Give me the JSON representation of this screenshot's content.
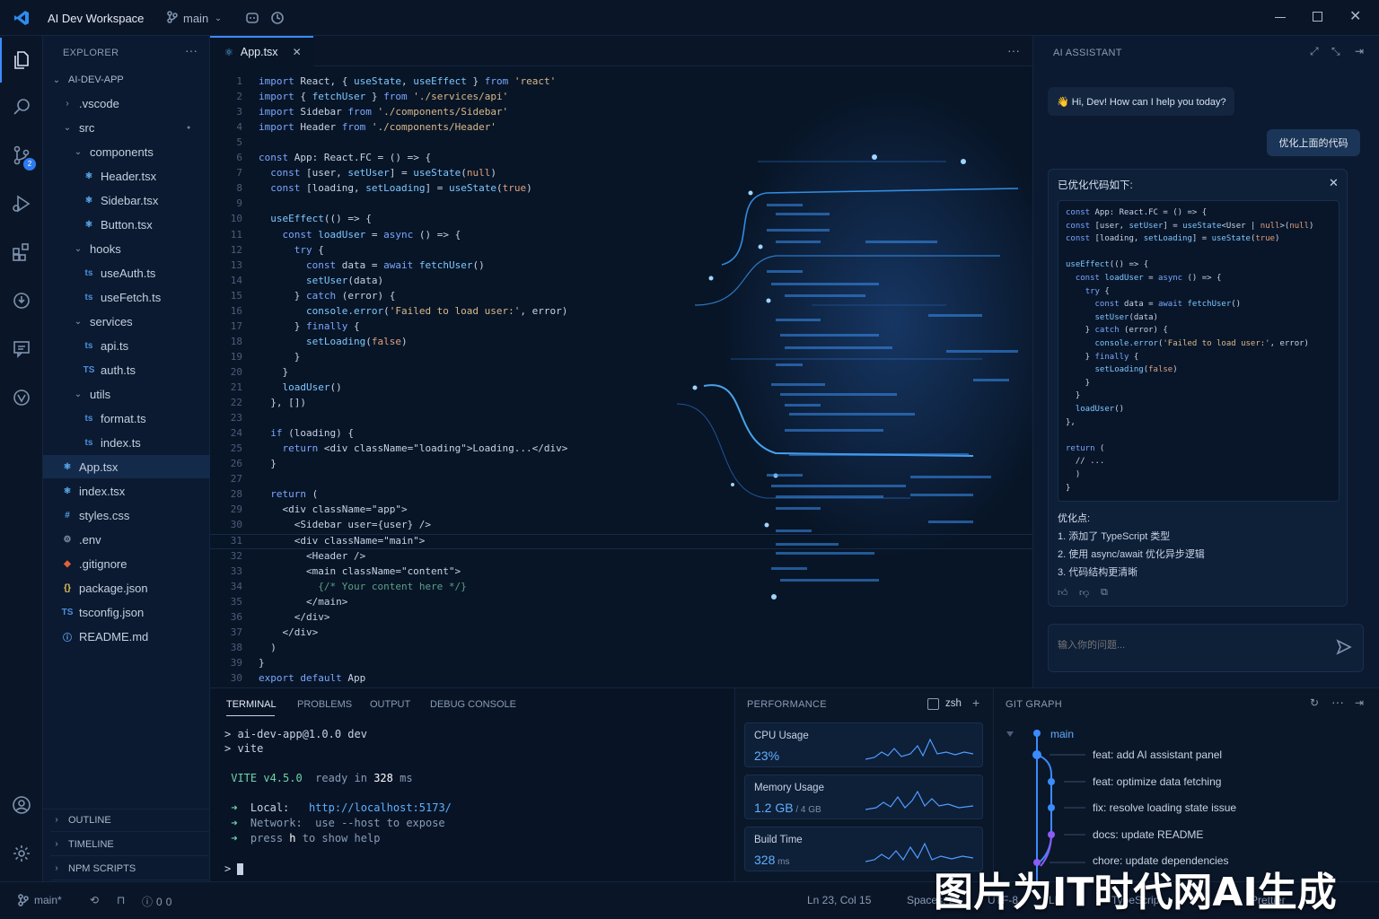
{
  "window": {
    "app_title": "AI Dev Workspace",
    "branch": "main"
  },
  "explorer": {
    "title": "EXPLORER",
    "root": "AI-DEV-APP",
    "items": [
      {
        "label": ".vscode",
        "kind": "folder-closed",
        "depth": 1
      },
      {
        "label": "src",
        "kind": "folder-open",
        "depth": 1
      },
      {
        "label": "components",
        "kind": "folder-open",
        "depth": 2
      },
      {
        "label": "Header.tsx",
        "kind": "tsx",
        "depth": 3
      },
      {
        "label": "Sidebar.tsx",
        "kind": "tsx",
        "depth": 3
      },
      {
        "label": "Button.tsx",
        "kind": "tsx",
        "depth": 3
      },
      {
        "label": "hooks",
        "kind": "folder-open",
        "depth": 2
      },
      {
        "label": "useAuth.ts",
        "kind": "ts",
        "depth": 3
      },
      {
        "label": "useFetch.ts",
        "kind": "ts",
        "depth": 3
      },
      {
        "label": "services",
        "kind": "folder-open",
        "depth": 2
      },
      {
        "label": "api.ts",
        "kind": "ts",
        "depth": 3
      },
      {
        "label": "auth.ts",
        "kind": "ts2",
        "depth": 3
      },
      {
        "label": "utils",
        "kind": "folder-open",
        "depth": 2
      },
      {
        "label": "format.ts",
        "kind": "ts",
        "depth": 3
      },
      {
        "label": "index.ts",
        "kind": "ts",
        "depth": 3
      },
      {
        "label": "App.tsx",
        "kind": "tsx",
        "depth": 1,
        "active": true
      },
      {
        "label": "index.tsx",
        "kind": "tsx",
        "depth": 1
      },
      {
        "label": "styles.css",
        "kind": "css",
        "depth": 1
      },
      {
        "label": ".env",
        "kind": "env",
        "depth": 1
      },
      {
        "label": ".gitignore",
        "kind": "git",
        "depth": 1
      },
      {
        "label": "package.json",
        "kind": "json",
        "depth": 1
      },
      {
        "label": "tsconfig.json",
        "kind": "tsconfig",
        "depth": 1
      },
      {
        "label": "README.md",
        "kind": "md",
        "depth": 1
      }
    ],
    "sections": [
      "OUTLINE",
      "TIMELINE",
      "NPM SCRIPTS"
    ]
  },
  "editor": {
    "tab_label": "App.tsx",
    "line_numbers": [
      "1",
      "2",
      "3",
      "4",
      "5",
      "6",
      "7",
      "8",
      "9",
      "10",
      "11",
      "12",
      "13",
      "14",
      "15",
      "16",
      "17",
      "18",
      "19",
      "20",
      "21",
      "22",
      "23",
      "24",
      "25",
      "26",
      "27",
      "28",
      "29",
      "30",
      "31",
      "32",
      "33",
      "34",
      "35",
      "36",
      "37",
      "38",
      "39",
      "30",
      "33"
    ],
    "lines": [
      "import React, { useState, useEffect } from 'react'",
      "import { fetchUser } from './services/api'",
      "import Sidebar from './components/Sidebar'",
      "import Header from './components/Header'",
      "",
      "const App: React.FC = () => {",
      "  const [user, setUser] = useState(null)",
      "  const [loading, setLoading] = useState(true)",
      "",
      "  useEffect(() => {",
      "    const loadUser = async () => {",
      "      try {",
      "        const data = await fetchUser()",
      "        setUser(data)",
      "      } catch (error) {",
      "        console.error('Failed to load user:', error)",
      "      } finally {",
      "        setLoading(false)",
      "      }",
      "    }",
      "    loadUser()",
      "  }, [])",
      "",
      "  if (loading) {",
      "    return <div className=\"loading\">Loading...</div>",
      "  }",
      "",
      "  return (",
      "    <div className=\"app\">",
      "      <Sidebar user={user} />",
      "      <div className=\"main\">",
      "        <Header />",
      "        <main className=\"content\">",
      "          {/* Your content here */}",
      "        </main>",
      "      </div>",
      "    </div>",
      "  )",
      "}",
      "export default App"
    ]
  },
  "assistant": {
    "title": "AI ASSISTANT",
    "greeting": "👋 Hi, Dev! How can I help you today?",
    "user_message": "优化上面的代码",
    "reply_header": "已优化代码如下:",
    "code": [
      "const App: React.FC = () => {",
      "const [user, setUser] = useState<User | null>(null)",
      "const [loading, setLoading] = useState(true)",
      "",
      "useEffect(() => {",
      "  const loadUser = async () => {",
      "    try {",
      "      const data = await fetchUser()",
      "      setUser(data)",
      "    } catch (error) {",
      "      console.error('Failed to load user:', error)",
      "    } finally {",
      "      setLoading(false)",
      "    }",
      "  }",
      "  loadUser()",
      "},",
      "",
      "return (",
      "  // ...",
      "  )",
      "}"
    ],
    "points_title": "优化点:",
    "points": [
      "1. 添加了 TypeScript 类型",
      "2. 使用 async/await 优化异步逻辑",
      "3. 代码结构更清晰"
    ],
    "input_placeholder": "输入你的问题..."
  },
  "terminal": {
    "tabs": [
      "TERMINAL",
      "PROBLEMS",
      "OUTPUT",
      "DEBUG CONSOLE"
    ],
    "lines": [
      {
        "p": "> ",
        "t": "ai-dev-app@1.0.0 dev"
      },
      {
        "p": "> ",
        "t": "vite"
      },
      {
        "vite": "VITE v4.5.0",
        "ready": "ready in ",
        "ms": "328",
        "unit": " ms"
      },
      {
        "arrow": "➜",
        "k": "Local:",
        "v": "http://localhost:5173/"
      },
      {
        "arrow": "➜",
        "k": "Network:",
        "v": "use --host to expose"
      },
      {
        "arrow": "➜",
        "k": "press",
        "v": "h to show help"
      }
    ],
    "prompt": ">"
  },
  "performance": {
    "title": "PERFORMANCE",
    "shell": "zsh",
    "cards": [
      {
        "label": "CPU Usage",
        "value": "23%",
        "sub": ""
      },
      {
        "label": "Memory Usage",
        "value": "1.2 GB",
        "sub": "/ 4 GB"
      },
      {
        "label": "Build Time",
        "value": "328",
        "sub": "ms"
      }
    ]
  },
  "git": {
    "title": "GIT GRAPH",
    "branch": "main",
    "commits": [
      "feat: add AI assistant panel",
      "feat: optimize data fetching",
      "fix: resolve loading state issue",
      "docs: update README",
      "chore: update dependencies"
    ]
  },
  "status": {
    "branch": "main*",
    "errors": "0",
    "warnings": "0",
    "position": "Ln 23, Col 15",
    "spaces": "Spaces: 2",
    "encoding": "UTF-8",
    "eol": "LF",
    "language": "TypeScript",
    "prettier": "Prettier"
  },
  "watermark": "图片为IT时代网AI生成",
  "colors": {
    "accent": "#3b8cff",
    "background": "#071325",
    "git_purple": "#8b5cf6"
  }
}
